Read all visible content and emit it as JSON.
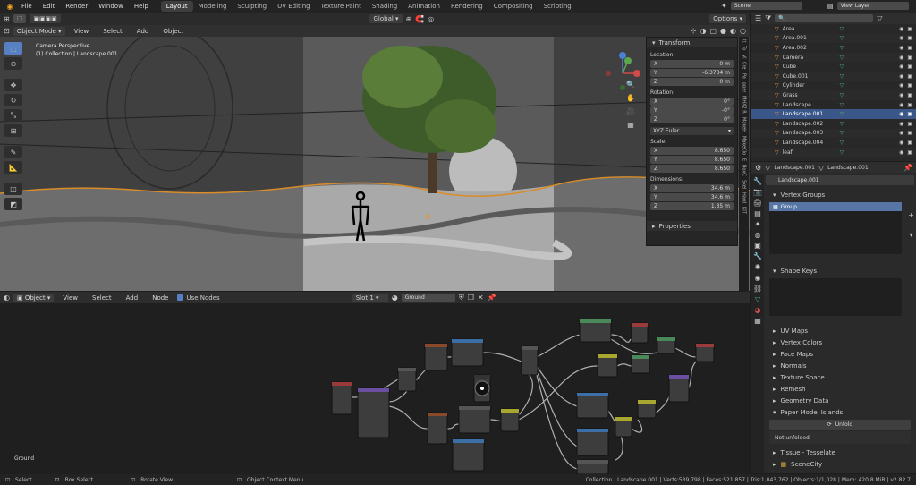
{
  "menus": [
    "File",
    "Edit",
    "Render",
    "Window",
    "Help"
  ],
  "workspaces": [
    "Layout",
    "Modeling",
    "Sculpting",
    "UV Editing",
    "Texture Paint",
    "Shading",
    "Animation",
    "Rendering",
    "Compositing",
    "Scripting"
  ],
  "scene": "Scene",
  "view_layer": "View Layer",
  "viewport": {
    "mode": "Object Mode",
    "menus": [
      "View",
      "Select",
      "Add",
      "Object"
    ],
    "orientation": "Global",
    "options": "Options",
    "perspective": "Camera Perspective",
    "collection_info": "(1) Collection | Landscape.001"
  },
  "npanel": {
    "title": "Transform",
    "location_label": "Location:",
    "location": [
      {
        "a": "X",
        "v": "0 m"
      },
      {
        "a": "Y",
        "v": "-6.3734 m"
      },
      {
        "a": "Z",
        "v": "0 m"
      }
    ],
    "rotation_label": "Rotation:",
    "rotation": [
      {
        "a": "X",
        "v": "0°"
      },
      {
        "a": "Y",
        "v": "-0°"
      },
      {
        "a": "Z",
        "v": "0°"
      }
    ],
    "euler": "XYZ Euler",
    "scale_label": "Scale:",
    "scale": [
      {
        "a": "X",
        "v": "8.650"
      },
      {
        "a": "Y",
        "v": "8.650"
      },
      {
        "a": "Z",
        "v": "8.650"
      }
    ],
    "dimensions_label": "Dimensions:",
    "dimensions": [
      {
        "a": "X",
        "v": "34.6 m"
      },
      {
        "a": "Y",
        "v": "34.6 m"
      },
      {
        "a": "Z",
        "v": "1.35 m"
      }
    ],
    "properties": "Properties",
    "tabs": [
      "It",
      "To",
      "Vi",
      "Cre",
      "Pa",
      "pper",
      "MHX2 R",
      "MakeH",
      "MakeClo",
      "E",
      "BoxC",
      "Skel",
      "Hard",
      "KIT"
    ]
  },
  "outliner": {
    "items": [
      {
        "name": "Area",
        "sel": false
      },
      {
        "name": "Area.001",
        "sel": false
      },
      {
        "name": "Area.002",
        "sel": false
      },
      {
        "name": "Camera",
        "sel": false
      },
      {
        "name": "Cube",
        "sel": false
      },
      {
        "name": "Cube.001",
        "sel": false
      },
      {
        "name": "Cylinder",
        "sel": false
      },
      {
        "name": "Grass",
        "sel": false
      },
      {
        "name": "Landscape",
        "sel": false
      },
      {
        "name": "Landscape.001",
        "sel": true
      },
      {
        "name": "Landscape.002",
        "sel": false
      },
      {
        "name": "Landscape.003",
        "sel": false
      },
      {
        "name": "Landscape.004",
        "sel": false
      },
      {
        "name": "leaf",
        "sel": false
      }
    ]
  },
  "properties": {
    "object": "Landscape.001",
    "mesh": "Landscape.001",
    "mesh_field": "Landscape.001",
    "vertex_groups": "Vertex Groups",
    "group": "Group",
    "shape_keys": "Shape Keys",
    "sections": [
      "UV Maps",
      "Vertex Colors",
      "Face Maps",
      "Normals",
      "Texture Space",
      "Remesh",
      "Geometry Data"
    ],
    "paper": "Paper Model Islands",
    "unfold": "Unfold",
    "not_unfolded": "Not unfolded",
    "tissue": "Tissue - Tesselate",
    "scenecity": "SceneCity"
  },
  "node_editor": {
    "type": "Object",
    "menus": [
      "View",
      "Select",
      "Add",
      "Node"
    ],
    "use_nodes": "Use Nodes",
    "slot": "Slot 1",
    "material": "Ground",
    "label": "Ground"
  },
  "status": {
    "select": "Select",
    "box_select": "Box Select",
    "rotate": "Rotate View",
    "context": "Object Context Menu",
    "stats": "Collection | Landscape.001 | Verts:539,798 | Faces:521,857 | Tris:1,043,762 | Objects:1/1,028 | Mem: 420.8 MiB | v2.82.7"
  }
}
